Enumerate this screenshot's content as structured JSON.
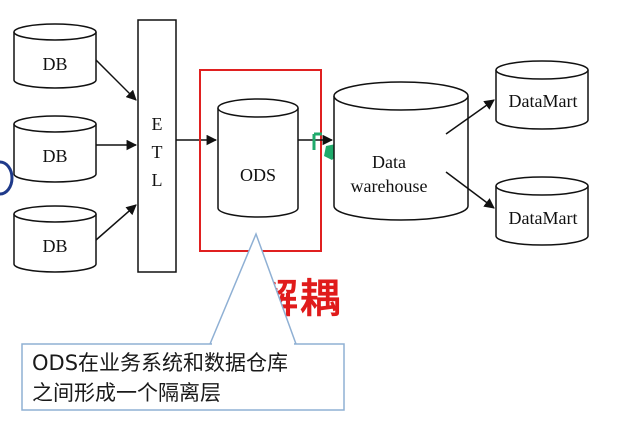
{
  "diagram": {
    "sources": [
      {
        "label": "DB"
      },
      {
        "label": "DB"
      },
      {
        "label": "DB"
      }
    ],
    "etl": {
      "letters": [
        "E",
        "T",
        "L"
      ]
    },
    "ods": {
      "label": "ODS"
    },
    "warehouse": {
      "line1": "Data",
      "line2": "warehouse"
    },
    "marts": [
      {
        "label": "DataMart"
      },
      {
        "label": "DataMart"
      }
    ],
    "annotation_title": "解耦",
    "callout": {
      "line1": "ODS在业务系统和数据仓库",
      "line2": "之间形成一个隔离层"
    },
    "colors": {
      "highlight_box": "#e02020",
      "annotation_text": "#e01b1b",
      "callout_border": "#8fb0d4",
      "line": "#111111",
      "green_mark": "#1faa6b"
    }
  }
}
